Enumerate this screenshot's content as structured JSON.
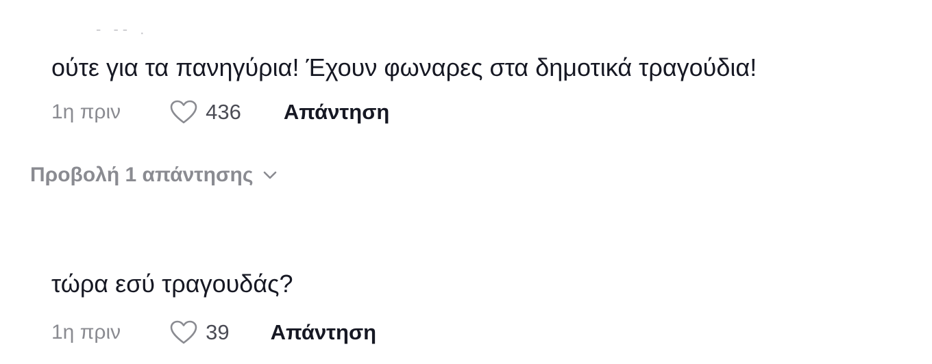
{
  "comments": [
    {
      "text": "ούτε για τα πανηγύρια! Έχουν φωναρες στα δημοτικά τραγούδια!",
      "time": "1η πριν",
      "likes": "436",
      "reply_label": "Απάντηση"
    },
    {
      "text": "τώρα εσύ τραγουδάς?",
      "time": "1η πριν",
      "likes": "39",
      "reply_label": "Απάντηση"
    }
  ],
  "view_replies_label": "Προβολή 1 απάντησης",
  "icons": {
    "like": "heart-outline-icon",
    "expand": "chevron-down-icon"
  },
  "colors": {
    "text": "#161823",
    "muted": "#8a8b91",
    "count": "#4b4c55"
  }
}
